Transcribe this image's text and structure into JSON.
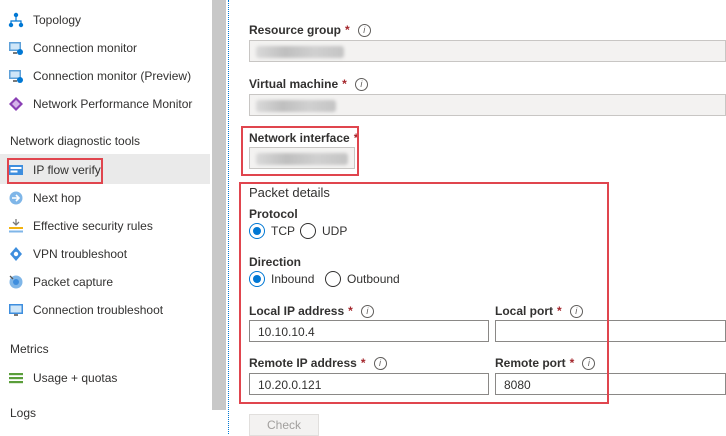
{
  "sidebar": {
    "items_top": [
      {
        "label": "Topology",
        "icon": "topology-icon"
      },
      {
        "label": "Connection monitor",
        "icon": "connection-monitor-icon"
      },
      {
        "label": "Connection monitor (Preview)",
        "icon": "connection-monitor-preview-icon"
      },
      {
        "label": "Network Performance Monitor",
        "icon": "network-performance-monitor-icon"
      }
    ],
    "section_diag": "Network diagnostic tools",
    "items_diag": [
      {
        "label": "IP flow verify",
        "icon": "ip-flow-verify-icon"
      },
      {
        "label": "Next hop",
        "icon": "next-hop-icon"
      },
      {
        "label": "Effective security rules",
        "icon": "effective-security-rules-icon"
      },
      {
        "label": "VPN troubleshoot",
        "icon": "vpn-troubleshoot-icon"
      },
      {
        "label": "Packet capture",
        "icon": "packet-capture-icon"
      },
      {
        "label": "Connection troubleshoot",
        "icon": "connection-troubleshoot-icon"
      }
    ],
    "section_metrics": "Metrics",
    "items_metrics": [
      {
        "label": "Usage + quotas",
        "icon": "usage-quotas-icon"
      }
    ],
    "section_logs": "Logs"
  },
  "form": {
    "resource_group_label": "Resource group",
    "virtual_machine_label": "Virtual machine",
    "network_interface_label": "Network interface",
    "required_mark": "*",
    "info_glyph": "i",
    "packet_details_title": "Packet details",
    "protocol_label": "Protocol",
    "protocol_options": [
      "TCP",
      "UDP"
    ],
    "protocol_selected": "TCP",
    "direction_label": "Direction",
    "direction_options": [
      "Inbound",
      "Outbound"
    ],
    "direction_selected": "Inbound",
    "local_ip_label": "Local IP address",
    "local_ip_value": "10.10.10.4",
    "local_port_label": "Local port",
    "local_port_value": "",
    "remote_ip_label": "Remote IP address",
    "remote_ip_value": "10.20.0.121",
    "remote_port_label": "Remote port",
    "remote_port_value": "8080",
    "check_button": "Check"
  },
  "colors": {
    "highlight_box": "#e0454e",
    "accent": "#0078d4",
    "required": "#a4262c"
  }
}
